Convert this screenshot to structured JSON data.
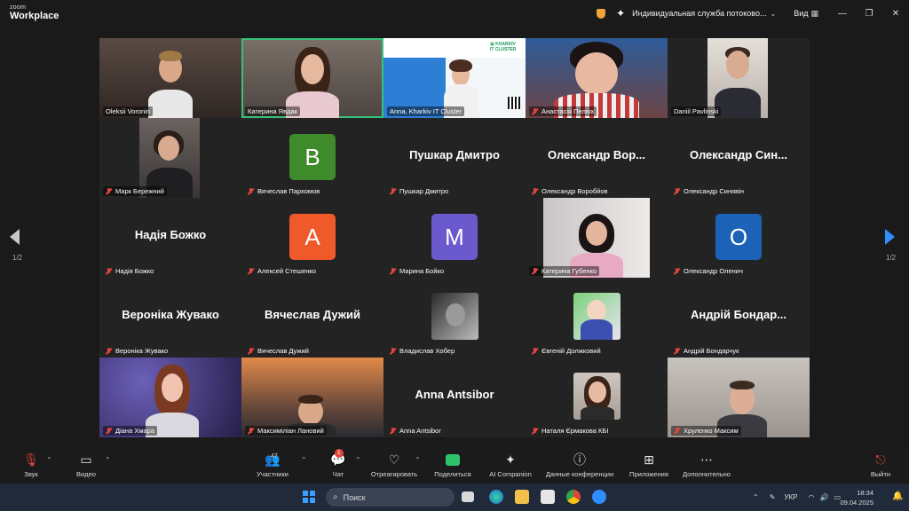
{
  "app": {
    "logo_line1": "zoom",
    "logo_line2": "Workplace"
  },
  "titlebar": {
    "title": "Индивидуальная служба потоково...",
    "view_label": "Вид"
  },
  "pager": {
    "left": "1/2",
    "right": "1/2"
  },
  "participants": [
    {
      "name": "Oleksii Voronin",
      "kind": "video"
    },
    {
      "name": "Катерина Явдак",
      "kind": "video",
      "active": true
    },
    {
      "name": "Anna, Kharkiv IT Cluster",
      "kind": "slide"
    },
    {
      "name": "Анастасія Пелюх",
      "kind": "video",
      "muted": true
    },
    {
      "name": "Daniil Pavlinski",
      "kind": "video"
    },
    {
      "name": "Марк Бережний",
      "kind": "video",
      "muted": true
    },
    {
      "name": "Вячеслав Пархомов",
      "kind": "avatar",
      "letter": "B",
      "color": "#3f8a2a",
      "muted": true
    },
    {
      "name": "Пушкар Дмитро",
      "kind": "name",
      "display": "Пушкар Дмитро",
      "muted": true
    },
    {
      "name": "Олександр Воробйов",
      "kind": "name",
      "display": "Олександр  Вор...",
      "muted": true
    },
    {
      "name": "Олександр Синявін",
      "kind": "name",
      "display": "Олександр  Син...",
      "muted": true
    },
    {
      "name": "Надія Божко",
      "kind": "name",
      "display": "Надія Божко",
      "muted": true
    },
    {
      "name": "Алексей Стешенко",
      "kind": "avatar",
      "letter": "A",
      "color": "#f0592a",
      "muted": true
    },
    {
      "name": "Марина Бойко",
      "kind": "avatar",
      "letter": "M",
      "color": "#6a5acd",
      "muted": true
    },
    {
      "name": "Катерина Губенко",
      "kind": "video",
      "muted": true
    },
    {
      "name": "Олександр Оленич",
      "kind": "avatar",
      "letter": "O",
      "color": "#1c63b7",
      "muted": true
    },
    {
      "name": "Вероніка Жувако",
      "kind": "name",
      "display": "Вероніка Жувако",
      "muted": true
    },
    {
      "name": "Вячеслав Дужий",
      "kind": "name",
      "display": "Вячеслав Дужий",
      "muted": true
    },
    {
      "name": "Владислав Хобер",
      "kind": "photo",
      "muted": true
    },
    {
      "name": "Євгеній Должковий",
      "kind": "photo",
      "muted": true
    },
    {
      "name": "Андрій Бондарчук",
      "kind": "name",
      "display": "Андрій  Бондар...",
      "muted": true
    },
    {
      "name": "Діана Хмара",
      "kind": "video",
      "muted": true
    },
    {
      "name": "Максиміліан Лановий",
      "kind": "video",
      "muted": true
    },
    {
      "name": "Anna Antsibor",
      "kind": "name",
      "display": "Anna Antsibor",
      "muted": true
    },
    {
      "name": "Наталя Єрмакова КБІ",
      "kind": "video",
      "muted": true
    },
    {
      "name": "Хрулєнко Максим",
      "kind": "video",
      "muted": true
    }
  ],
  "controls": {
    "audio": "Звук",
    "video": "Видео",
    "participants": "Участники",
    "participants_count": "47",
    "chat": "Чат",
    "chat_badge": "1",
    "react": "Отреагировать",
    "share": "Поделиться",
    "ai": "AI Companion",
    "info": "Данные конференции",
    "apps": "Приложения",
    "more": "Дополнительно",
    "leave": "Выйти"
  },
  "taskbar": {
    "search_placeholder": "Поиск",
    "lang": "УКР",
    "time": "18:34",
    "date": "09.04.2025"
  }
}
